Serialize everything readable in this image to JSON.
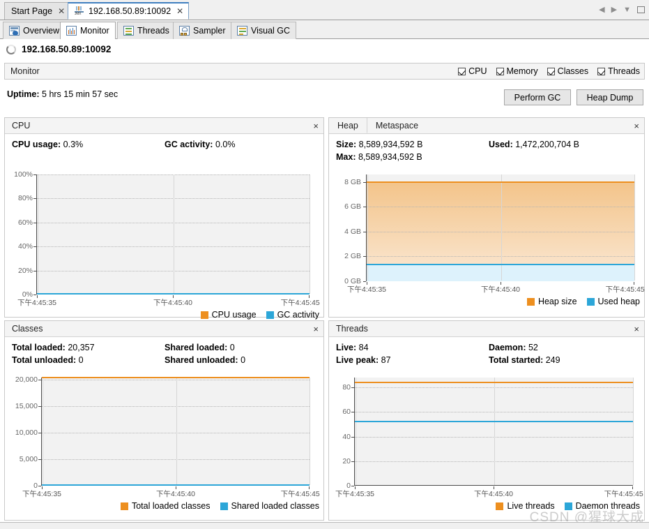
{
  "window": {
    "document_tabs": [
      {
        "label": "Start Page",
        "icon": "",
        "active": false,
        "closable": true
      },
      {
        "label": "192.168.50.89:10092",
        "icon": "jmx-icon",
        "active": true,
        "closable": true
      }
    ],
    "nav_controls": [
      {
        "name": "scroll-left-icon",
        "glyph": "◀"
      },
      {
        "name": "scroll-right-icon",
        "glyph": "▶"
      },
      {
        "name": "tab-list-dropdown-icon",
        "glyph": "▼"
      },
      {
        "name": "maximize-icon",
        "glyph": ""
      }
    ]
  },
  "view_tabs": [
    {
      "label": "Overview",
      "icon": "overview-icon",
      "active": false
    },
    {
      "label": "Monitor",
      "icon": "monitor-icon",
      "active": true
    },
    {
      "label": "Threads",
      "icon": "threads-icon",
      "active": false
    },
    {
      "label": "Sampler",
      "icon": "sampler-icon",
      "active": false
    },
    {
      "label": "Visual GC",
      "icon": "visualgc-icon",
      "active": false
    }
  ],
  "process": {
    "title": "192.168.50.89:10092",
    "status_icon": "spinner-icon"
  },
  "monitor": {
    "header_title": "Monitor",
    "toggles": [
      {
        "label": "CPU",
        "checked": true
      },
      {
        "label": "Memory",
        "checked": true
      },
      {
        "label": "Classes",
        "checked": true
      },
      {
        "label": "Threads",
        "checked": true
      }
    ],
    "uptime_label": "Uptime:",
    "uptime_value": "5 hrs 15 min 57 sec",
    "buttons": [
      {
        "label": "Perform GC",
        "name": "perform-gc-button"
      },
      {
        "label": "Heap Dump",
        "name": "heap-dump-button"
      }
    ]
  },
  "panels": {
    "cpu": {
      "title": "CPU",
      "close_glyph": "×",
      "stats": [
        {
          "label": "CPU usage:",
          "value": "0.3%"
        },
        {
          "label": "GC activity:",
          "value": "0.0%"
        }
      ]
    },
    "heap": {
      "tabs": [
        {
          "label": "Heap",
          "selected": true
        },
        {
          "label": "Metaspace",
          "selected": false
        }
      ],
      "close_glyph": "×",
      "stats": [
        {
          "label": "Size:",
          "value": "8,589,934,592 B"
        },
        {
          "label": "Used:",
          "value": "1,472,200,704 B"
        },
        {
          "label": "Max:",
          "value": "8,589,934,592 B"
        }
      ]
    },
    "classes": {
      "title": "Classes",
      "close_glyph": "×",
      "stats": [
        {
          "label": "Total loaded:",
          "value": "20,357"
        },
        {
          "label": "Shared loaded:",
          "value": "0"
        },
        {
          "label": "Total unloaded:",
          "value": "0"
        },
        {
          "label": "Shared unloaded:",
          "value": "0"
        }
      ]
    },
    "threads": {
      "title": "Threads",
      "close_glyph": "×",
      "stats": [
        {
          "label": "Live:",
          "value": "84"
        },
        {
          "label": "Daemon:",
          "value": "52"
        },
        {
          "label": "Live peak:",
          "value": "87"
        },
        {
          "label": "Total started:",
          "value": "249"
        }
      ]
    }
  },
  "colors": {
    "orange": "#ed8f1f",
    "blue": "#2ca6d8",
    "orange_fill_top": "#f3c48a",
    "orange_fill_bottom": "#fbe9d6",
    "blue_fill": "#ddf2fc",
    "plot_bg": "#f2f2f2",
    "axis": "#4a4a4a",
    "grid": "#b4b4b4"
  },
  "watermark": "CSDN @猩球大成",
  "chart_data": [
    {
      "type": "line",
      "name": "cpu-chart",
      "title": "CPU",
      "xlabel": "",
      "ylabel": "",
      "x": [
        "下午4:45:35",
        "下午4:45:40",
        "下午4:45:45"
      ],
      "xtick_labels": [
        "下午4:45:35",
        "下午4:45:40",
        "下午4:45:45"
      ],
      "ytick_labels": [
        "0%",
        "20%",
        "40%",
        "60%",
        "80%",
        "100%"
      ],
      "ylim": [
        0,
        100
      ],
      "yticks": [
        0,
        20,
        40,
        60,
        80,
        100
      ],
      "grid": true,
      "legend_position": "bottom-right",
      "series": [
        {
          "name": "CPU usage",
          "color": "#ed8f1f",
          "values": [
            0.3,
            0.3,
            0.3
          ]
        },
        {
          "name": "GC activity",
          "color": "#2ca6d8",
          "values": [
            0.0,
            0.0,
            0.0
          ]
        }
      ]
    },
    {
      "type": "area",
      "name": "heap-chart",
      "title": "Heap",
      "xlabel": "",
      "ylabel": "",
      "x": [
        "下午4:45:35",
        "下午4:45:40",
        "下午4:45:45"
      ],
      "xtick_labels": [
        "下午4:45:35",
        "下午4:45:40",
        "下午4:45:45"
      ],
      "ytick_labels": [
        "0 GB",
        "2 GB",
        "4 GB",
        "6 GB",
        "8 GB"
      ],
      "ylim": [
        0,
        8.59
      ],
      "yticks": [
        0,
        2,
        4,
        6,
        8
      ],
      "grid": true,
      "legend_position": "bottom-right",
      "series": [
        {
          "name": "Heap size",
          "color": "#ed8f1f",
          "values": [
            8.0,
            8.0,
            8.0
          ]
        },
        {
          "name": "Used heap",
          "color": "#2ca6d8",
          "values": [
            1.371,
            1.371,
            1.371
          ]
        }
      ]
    },
    {
      "type": "line",
      "name": "classes-chart",
      "title": "Classes",
      "xlabel": "",
      "ylabel": "",
      "x": [
        "下午4:45:35",
        "下午4:45:40",
        "下午4:45:45"
      ],
      "xtick_labels": [
        "下午4:45:35",
        "下午4:45:40",
        "下午4:45:45"
      ],
      "ytick_labels": [
        "0",
        "5,000",
        "10,000",
        "15,000",
        "20,000"
      ],
      "ylim": [
        0,
        20357
      ],
      "yticks": [
        0,
        5000,
        10000,
        15000,
        20000
      ],
      "grid": true,
      "legend_position": "bottom-right",
      "series": [
        {
          "name": "Total loaded classes",
          "color": "#ed8f1f",
          "values": [
            20357,
            20357,
            20357
          ]
        },
        {
          "name": "Shared loaded classes",
          "color": "#2ca6d8",
          "values": [
            0,
            0,
            0
          ]
        }
      ]
    },
    {
      "type": "line",
      "name": "threads-chart",
      "title": "Threads",
      "xlabel": "",
      "ylabel": "",
      "x": [
        "下午4:45:35",
        "下午4:45:40",
        "下午4:45:45"
      ],
      "xtick_labels": [
        "下午4:45:35",
        "下午4:45:40",
        "下午4:45:45"
      ],
      "ytick_labels": [
        "0",
        "20",
        "40",
        "60",
        "80"
      ],
      "ylim": [
        0,
        88
      ],
      "yticks": [
        0,
        20,
        40,
        60,
        80
      ],
      "grid": true,
      "legend_position": "bottom-right",
      "series": [
        {
          "name": "Live threads",
          "color": "#ed8f1f",
          "values": [
            84,
            84,
            84
          ]
        },
        {
          "name": "Daemon threads",
          "color": "#2ca6d8",
          "values": [
            52,
            52,
            52
          ]
        }
      ]
    }
  ]
}
